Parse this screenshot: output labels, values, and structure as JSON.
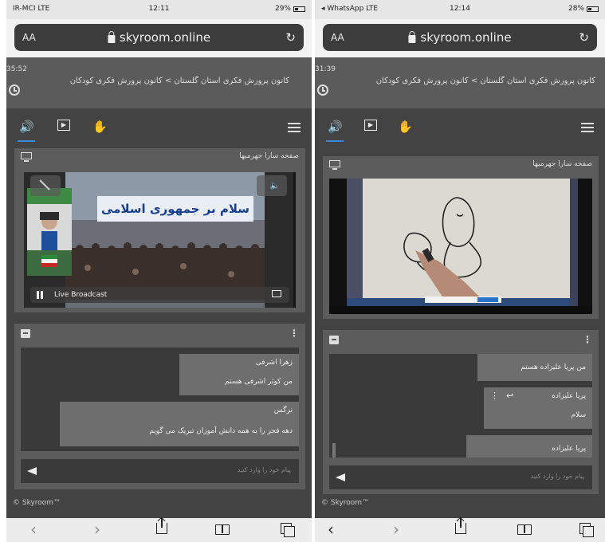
{
  "left": {
    "status": {
      "carrier": "IR-MCI LTE",
      "time": "12:11",
      "battery": "29%"
    },
    "browser": {
      "aa": "AA",
      "url": "skyroom.online",
      "reload": "↻"
    },
    "header": {
      "time": "35:52",
      "breadcrumb": "کانون پرورش فکری استان گلستان > کانون پرورش فکری کودکان"
    },
    "video_panel": {
      "title": "صفحه سارا جهرمیها"
    },
    "video": {
      "banner": "سلام بر جمهوری اسلامی",
      "live_label": "Live Broadcast"
    },
    "messages": [
      {
        "name": "زهرا اشرفی",
        "text": "من کوثر اشرفی هستم"
      },
      {
        "name": "نرگس",
        "text": "دهه فجر را به همه دانش آموزان تبریک می گویم"
      }
    ],
    "chat_placeholder": "پیام خود را وارد کنید",
    "footer": "© Skyroom™"
  },
  "right": {
    "status": {
      "carrier": "◂ WhatsApp LTE",
      "time": "12:14",
      "battery": "28%"
    },
    "browser": {
      "aa": "AA",
      "url": "skyroom.online",
      "reload": "↻"
    },
    "header": {
      "time": "31:39",
      "breadcrumb": "کانون پرورش فکری استان گلستان > کانون پرورش فکری کودکان"
    },
    "video_panel": {
      "title": "صفحه سارا جهرمیها"
    },
    "messages": [
      {
        "name": "",
        "text": "من پریا علیزاده هستم"
      },
      {
        "name": "پریا علیزاده",
        "text": "سلام"
      },
      {
        "name": "پریا علیزاده",
        "text": ""
      }
    ],
    "chat_placeholder": "پیام خود را وارد کنید",
    "footer": "© Skyroom™"
  },
  "icons": {
    "back": "‹",
    "forward": "›"
  },
  "colors": {
    "accent": "#3a86d8",
    "panel": "#5c5c5c",
    "app_bg": "#434343"
  }
}
